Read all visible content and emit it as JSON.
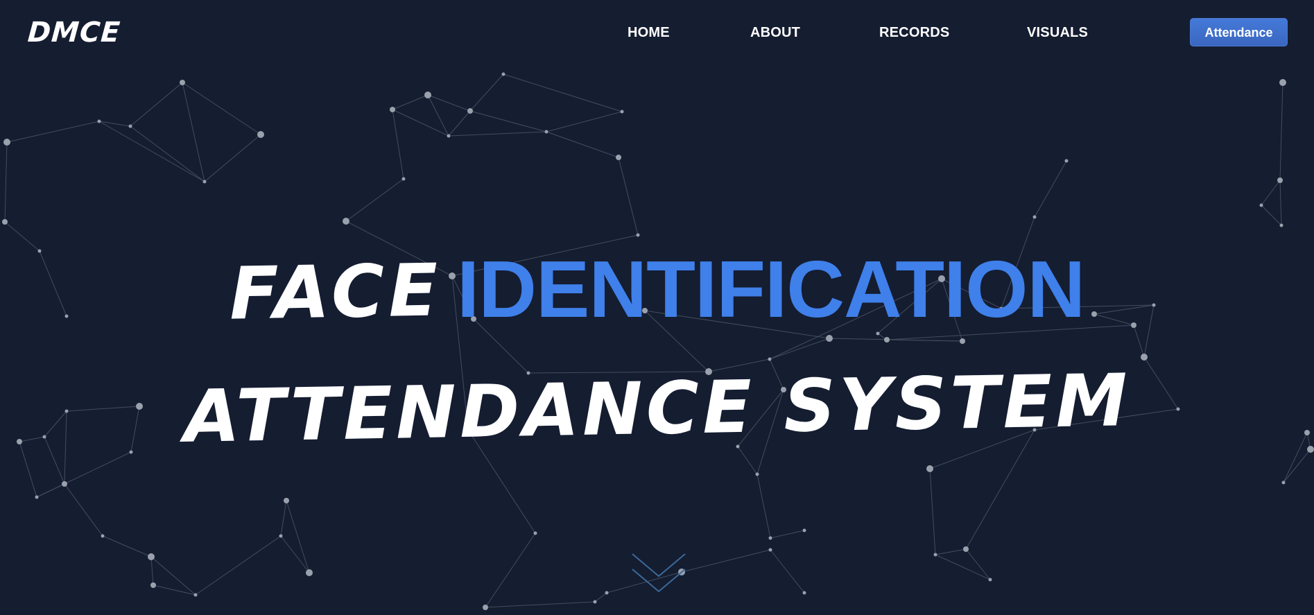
{
  "header": {
    "logo": "DMCE",
    "nav": [
      {
        "label": "HOME"
      },
      {
        "label": "ABOUT"
      },
      {
        "label": "RECORDS"
      },
      {
        "label": "VISUALS"
      }
    ],
    "cta_label": "Attendance"
  },
  "hero": {
    "title_word_1": "FACE",
    "title_word_2": "IDENTIFICATION",
    "title_line_2": "ATTENDANCE SYSTEM"
  },
  "scroll_indicator": {
    "icon": "double-chevron-down-icon"
  },
  "colors": {
    "background": "#151d31",
    "accent": "#3f80ea",
    "text": "#ffffff",
    "network_nodes": "#9aa1ad",
    "network_lines": "#6c7382"
  }
}
